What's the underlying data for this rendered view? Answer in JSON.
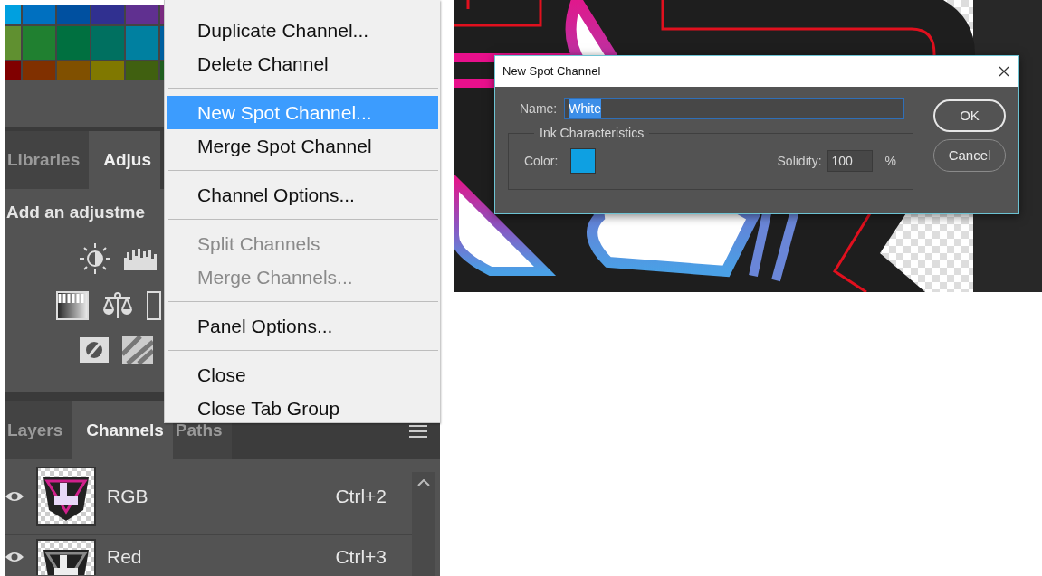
{
  "adjust_panel": {
    "tabs": [
      {
        "label": "Libraries",
        "selected": false
      },
      {
        "label": "Adjus",
        "selected": true
      }
    ],
    "hint": "Add an adjustme"
  },
  "channels_panel": {
    "tabs": [
      {
        "label": "Layers",
        "selected": false
      },
      {
        "label": "Channels",
        "selected": true
      },
      {
        "label": "Paths",
        "selected": false
      }
    ],
    "channels": [
      {
        "name": "RGB",
        "shortcut": "Ctrl+2",
        "visible": true
      },
      {
        "name": "Red",
        "shortcut": "Ctrl+3",
        "visible": true
      }
    ]
  },
  "context_menu": {
    "groups": [
      [
        {
          "label": "Duplicate Channel...",
          "selected": false,
          "disabled": false
        },
        {
          "label": "Delete Channel",
          "selected": false,
          "disabled": false
        }
      ],
      [
        {
          "label": "New Spot Channel...",
          "selected": true,
          "disabled": false
        },
        {
          "label": "Merge Spot Channel",
          "selected": false,
          "disabled": false
        }
      ],
      [
        {
          "label": "Channel Options...",
          "selected": false,
          "disabled": false
        }
      ],
      [
        {
          "label": "Split Channels",
          "selected": false,
          "disabled": true
        },
        {
          "label": "Merge Channels...",
          "selected": false,
          "disabled": true
        }
      ],
      [
        {
          "label": "Panel Options...",
          "selected": false,
          "disabled": false
        }
      ],
      [
        {
          "label": "Close",
          "selected": false,
          "disabled": false
        },
        {
          "label": "Close Tab Group",
          "selected": false,
          "disabled": false
        }
      ]
    ]
  },
  "dialog": {
    "title": "New Spot Channel",
    "name_label": "Name:",
    "name_value": "White",
    "name_selected": true,
    "fieldset": "Ink Characteristics",
    "color_label": "Color:",
    "color": "#0ea0e2",
    "solidity_label": "Solidity:",
    "solidity": "100",
    "percent": "%",
    "buttons": [
      {
        "label": "OK",
        "kind": "default"
      },
      {
        "label": "Cancel",
        "kind": "normal"
      }
    ]
  }
}
